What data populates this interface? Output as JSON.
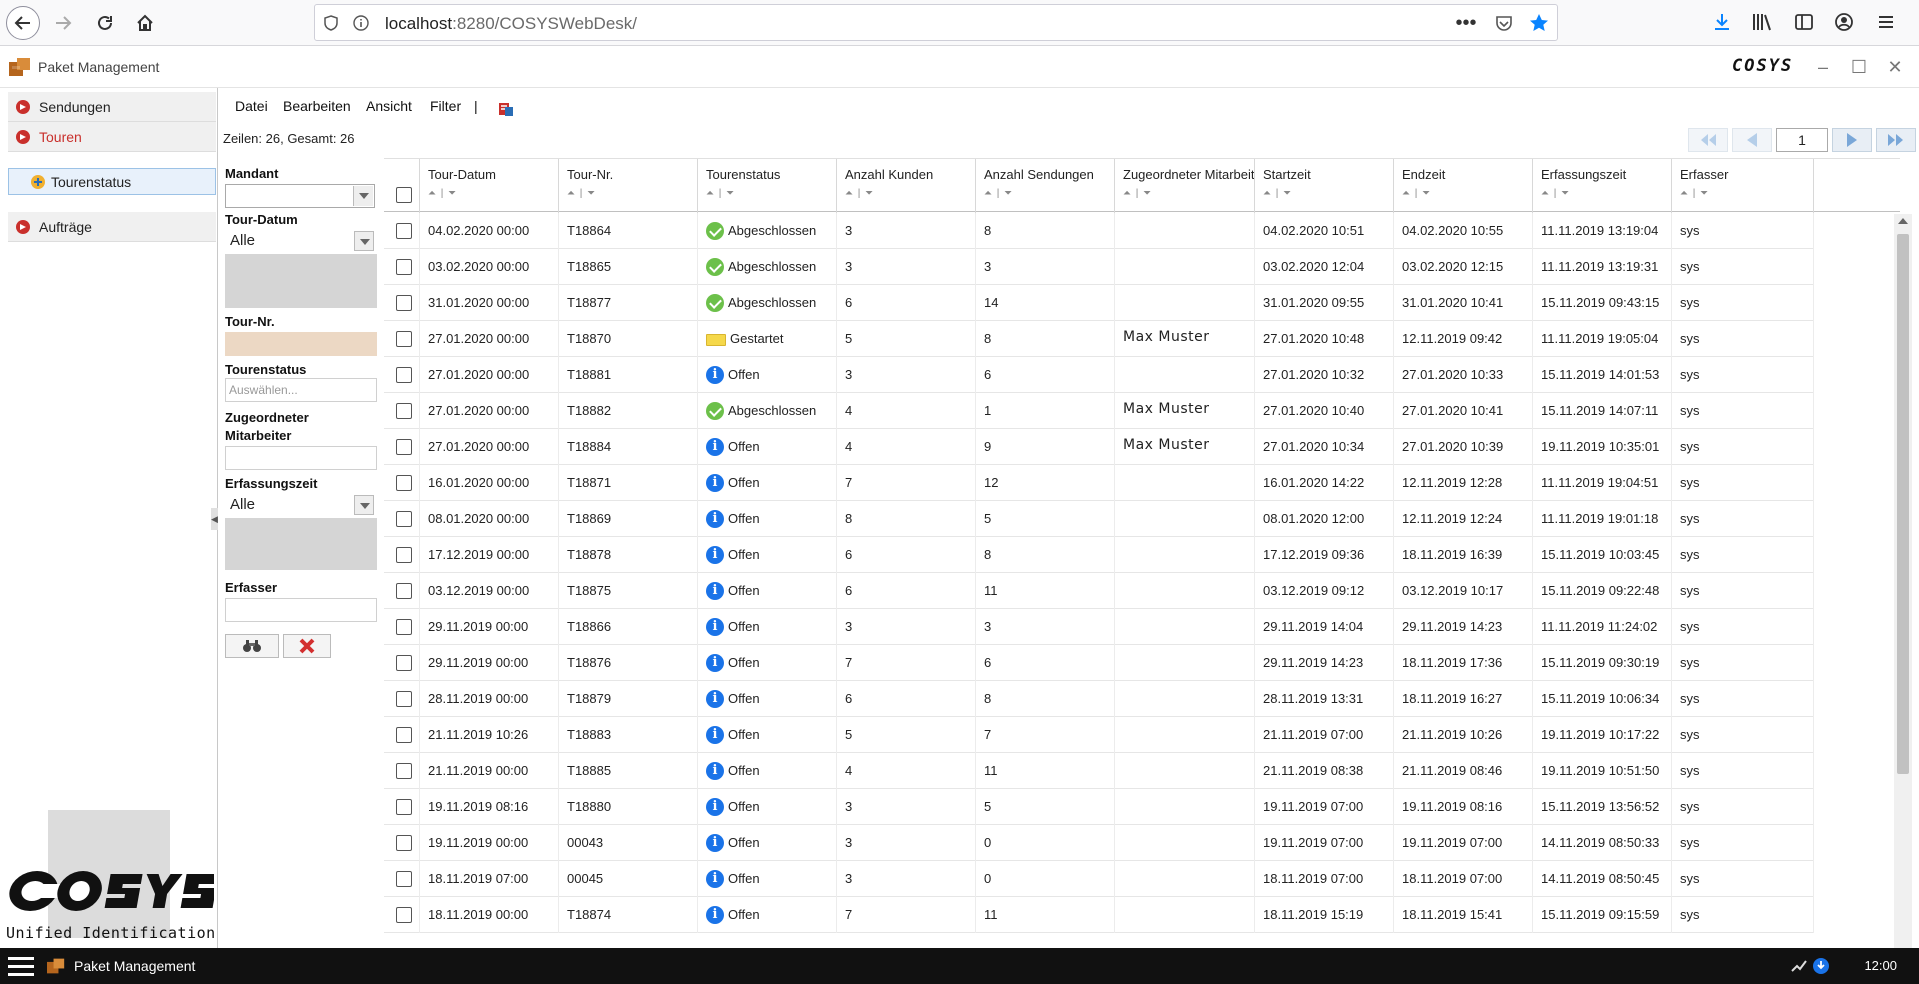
{
  "browser": {
    "url_host": "localhost",
    "url_rest": ":8280/COSYSWebDesk/"
  },
  "app": {
    "title": "Paket Management",
    "brand": "COSYS"
  },
  "nav": {
    "items": [
      {
        "label": "Sendungen"
      },
      {
        "label": "Touren"
      },
      {
        "label": "Tourenstatus"
      },
      {
        "label": "Aufträge"
      }
    ],
    "logo_subtitle": "Unified Identification"
  },
  "menubar": {
    "items": [
      "Datei",
      "Bearbeiten",
      "Ansicht",
      "Filter",
      "|"
    ]
  },
  "grid_info": "Zeilen: 26, Gesamt: 26",
  "pager": {
    "page": "1"
  },
  "filters": {
    "mandant_label": "Mandant",
    "tourdatum_label": "Tour-Datum",
    "tourdatum_value": "Alle",
    "tournr_label": "Tour-Nr.",
    "tourenstatus_label": "Tourenstatus",
    "tourenstatus_placeholder": "Auswählen...",
    "mitarbeiter_label_1": "Zugeordneter",
    "mitarbeiter_label_2": "Mitarbeiter",
    "erfassungszeit_label": "Erfassungszeit",
    "erfassungszeit_value": "Alle",
    "erfasser_label": "Erfasser"
  },
  "columns": [
    "Tour-Datum",
    "Tour-Nr.",
    "Tourenstatus",
    "Anzahl Kunden",
    "Anzahl Sendungen",
    "Zugeordneter Mitarbeiter",
    "Startzeit",
    "Endzeit",
    "Erfassungszeit",
    "Erfasser"
  ],
  "rows": [
    {
      "datum": "04.02.2020 00:00",
      "nr": "T18864",
      "status": "Abgeschlossen",
      "kunden": "3",
      "sendungen": "8",
      "mitarbeiter": "",
      "start": "04.02.2020 10:51",
      "ende": "04.02.2020 10:55",
      "erfasst": "11.11.2019 13:19:04",
      "erfasser": "sys"
    },
    {
      "datum": "03.02.2020 00:00",
      "nr": "T18865",
      "status": "Abgeschlossen",
      "kunden": "3",
      "sendungen": "3",
      "mitarbeiter": "",
      "start": "03.02.2020 12:04",
      "ende": "03.02.2020 12:15",
      "erfasst": "11.11.2019 13:19:31",
      "erfasser": "sys"
    },
    {
      "datum": "31.01.2020 00:00",
      "nr": "T18877",
      "status": "Abgeschlossen",
      "kunden": "6",
      "sendungen": "14",
      "mitarbeiter": "",
      "start": "31.01.2020 09:55",
      "ende": "31.01.2020 10:41",
      "erfasst": "15.11.2019 09:43:15",
      "erfasser": "sys"
    },
    {
      "datum": "27.01.2020 00:00",
      "nr": "T18870",
      "status": "Gestartet",
      "kunden": "5",
      "sendungen": "8",
      "mitarbeiter": "Max Muster",
      "start": "27.01.2020 10:48",
      "ende": "12.11.2019 09:42",
      "erfasst": "11.11.2019 19:05:04",
      "erfasser": "sys"
    },
    {
      "datum": "27.01.2020 00:00",
      "nr": "T18881",
      "status": "Offen",
      "kunden": "3",
      "sendungen": "6",
      "mitarbeiter": "",
      "start": "27.01.2020 10:32",
      "ende": "27.01.2020 10:33",
      "erfasst": "15.11.2019 14:01:53",
      "erfasser": "sys"
    },
    {
      "datum": "27.01.2020 00:00",
      "nr": "T18882",
      "status": "Abgeschlossen",
      "kunden": "4",
      "sendungen": "1",
      "mitarbeiter": "Max Muster",
      "start": "27.01.2020 10:40",
      "ende": "27.01.2020 10:41",
      "erfasst": "15.11.2019 14:07:11",
      "erfasser": "sys"
    },
    {
      "datum": "27.01.2020 00:00",
      "nr": "T18884",
      "status": "Offen",
      "kunden": "4",
      "sendungen": "9",
      "mitarbeiter": "Max Muster",
      "start": "27.01.2020 10:34",
      "ende": "27.01.2020 10:39",
      "erfasst": "19.11.2019 10:35:01",
      "erfasser": "sys"
    },
    {
      "datum": "16.01.2020 00:00",
      "nr": "T18871",
      "status": "Offen",
      "kunden": "7",
      "sendungen": "12",
      "mitarbeiter": "",
      "start": "16.01.2020 14:22",
      "ende": "12.11.2019 12:28",
      "erfasst": "11.11.2019 19:04:51",
      "erfasser": "sys"
    },
    {
      "datum": "08.01.2020 00:00",
      "nr": "T18869",
      "status": "Offen",
      "kunden": "8",
      "sendungen": "5",
      "mitarbeiter": "",
      "start": "08.01.2020 12:00",
      "ende": "12.11.2019 12:24",
      "erfasst": "11.11.2019 19:01:18",
      "erfasser": "sys"
    },
    {
      "datum": "17.12.2019 00:00",
      "nr": "T18878",
      "status": "Offen",
      "kunden": "6",
      "sendungen": "8",
      "mitarbeiter": "",
      "start": "17.12.2019 09:36",
      "ende": "18.11.2019 16:39",
      "erfasst": "15.11.2019 10:03:45",
      "erfasser": "sys"
    },
    {
      "datum": "03.12.2019 00:00",
      "nr": "T18875",
      "status": "Offen",
      "kunden": "6",
      "sendungen": "11",
      "mitarbeiter": "",
      "start": "03.12.2019 09:12",
      "ende": "03.12.2019 10:17",
      "erfasst": "15.11.2019 09:22:48",
      "erfasser": "sys"
    },
    {
      "datum": "29.11.2019 00:00",
      "nr": "T18866",
      "status": "Offen",
      "kunden": "3",
      "sendungen": "3",
      "mitarbeiter": "",
      "start": "29.11.2019 14:04",
      "ende": "29.11.2019 14:23",
      "erfasst": "11.11.2019 11:24:02",
      "erfasser": "sys"
    },
    {
      "datum": "29.11.2019 00:00",
      "nr": "T18876",
      "status": "Offen",
      "kunden": "7",
      "sendungen": "6",
      "mitarbeiter": "",
      "start": "29.11.2019 14:23",
      "ende": "18.11.2019 17:36",
      "erfasst": "15.11.2019 09:30:19",
      "erfasser": "sys"
    },
    {
      "datum": "28.11.2019 00:00",
      "nr": "T18879",
      "status": "Offen",
      "kunden": "6",
      "sendungen": "8",
      "mitarbeiter": "",
      "start": "28.11.2019 13:31",
      "ende": "18.11.2019 16:27",
      "erfasst": "15.11.2019 10:06:34",
      "erfasser": "sys"
    },
    {
      "datum": "21.11.2019 10:26",
      "nr": "T18883",
      "status": "Offen",
      "kunden": "5",
      "sendungen": "7",
      "mitarbeiter": "",
      "start": "21.11.2019 07:00",
      "ende": "21.11.2019 10:26",
      "erfasst": "19.11.2019 10:17:22",
      "erfasser": "sys"
    },
    {
      "datum": "21.11.2019 00:00",
      "nr": "T18885",
      "status": "Offen",
      "kunden": "4",
      "sendungen": "11",
      "mitarbeiter": "",
      "start": "21.11.2019 08:38",
      "ende": "21.11.2019 08:46",
      "erfasst": "19.11.2019 10:51:50",
      "erfasser": "sys"
    },
    {
      "datum": "19.11.2019 08:16",
      "nr": "T18880",
      "status": "Offen",
      "kunden": "3",
      "sendungen": "5",
      "mitarbeiter": "",
      "start": "19.11.2019 07:00",
      "ende": "19.11.2019 08:16",
      "erfasst": "15.11.2019 13:56:52",
      "erfasser": "sys"
    },
    {
      "datum": "19.11.2019 00:00",
      "nr": "00043",
      "status": "Offen",
      "kunden": "3",
      "sendungen": "0",
      "mitarbeiter": "",
      "start": "19.11.2019 07:00",
      "ende": "19.11.2019 07:00",
      "erfasst": "14.11.2019 08:50:33",
      "erfasser": "sys"
    },
    {
      "datum": "18.11.2019 07:00",
      "nr": "00045",
      "status": "Offen",
      "kunden": "3",
      "sendungen": "0",
      "mitarbeiter": "",
      "start": "18.11.2019 07:00",
      "ende": "18.11.2019 07:00",
      "erfasst": "14.11.2019 08:50:45",
      "erfasser": "sys"
    },
    {
      "datum": "18.11.2019 00:00",
      "nr": "T18874",
      "status": "Offen",
      "kunden": "7",
      "sendungen": "11",
      "mitarbeiter": "",
      "start": "18.11.2019 15:19",
      "ende": "18.11.2019 15:41",
      "erfasst": "15.11.2019 09:15:59",
      "erfasser": "sys"
    }
  ],
  "taskbar": {
    "app": "Paket Management",
    "clock": "12:00"
  },
  "colors": {
    "accent_red": "#c9302c",
    "status_done": "#6cc04a",
    "status_open": "#1a73e8",
    "status_started": "#f5d84a"
  }
}
